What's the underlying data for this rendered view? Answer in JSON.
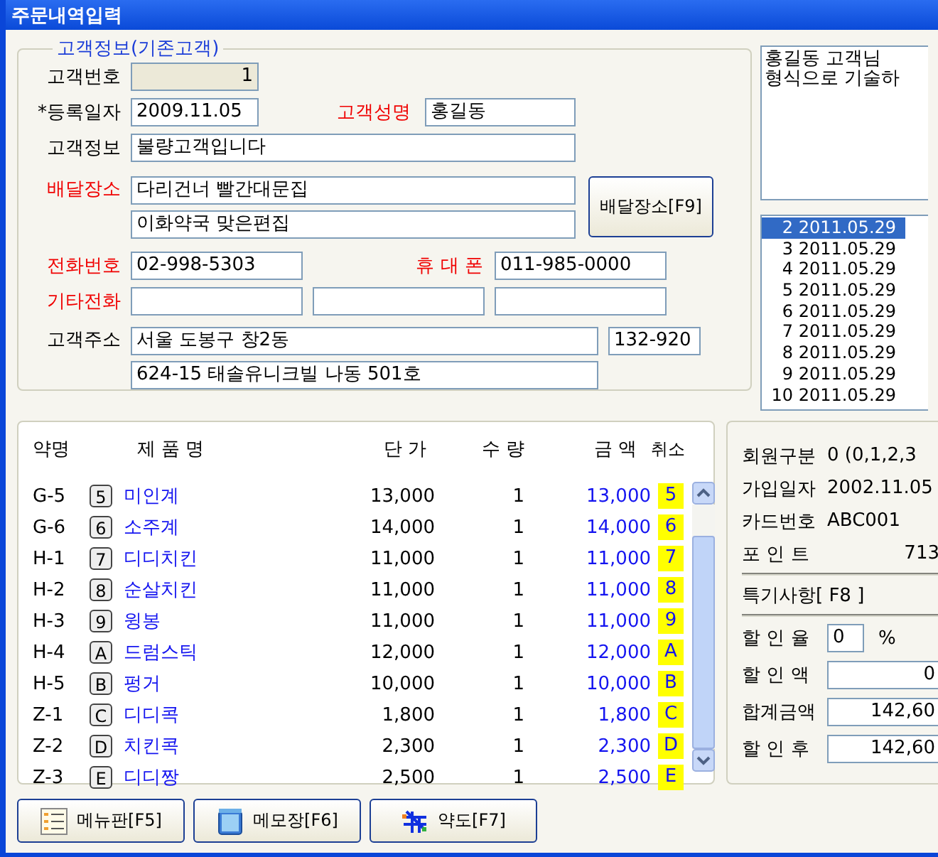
{
  "window": {
    "title": "주문내역입력"
  },
  "customer": {
    "legend": "고객정보(기존고객)",
    "number": {
      "label": "고객번호",
      "highlighted": false,
      "value": "1",
      "disabled": true
    },
    "reg_date": {
      "label": "*등록일자",
      "highlighted": false,
      "value": "2009.11.05"
    },
    "name": {
      "label": "고객성명",
      "highlighted": true,
      "value": "홍길동"
    },
    "info": {
      "label": "고객정보",
      "highlighted": false,
      "value": "불량고객입니다"
    },
    "delivery": {
      "label": "배달장소",
      "highlighted": true,
      "lines": [
        "다리건너 빨간대문집",
        "이화약국 맞은편집"
      ],
      "button": "배달장소[F9]"
    },
    "phone": {
      "label": "전화번호",
      "highlighted": true,
      "value": "02-998-5303"
    },
    "mobile": {
      "label": "휴 대 폰",
      "highlighted": true,
      "value": "011-985-0000"
    },
    "other_phone": {
      "label": "기타전화",
      "highlighted": true
    },
    "address": {
      "label": "고객주소",
      "highlighted": false,
      "lines": [
        "서울 도봉구 창2동",
        "624-15 태솔유니크빌 나동 501호"
      ],
      "zip": "132-920"
    }
  },
  "memo": {
    "lines": [
      "홍길동 고객님",
      "형식으로 기술하"
    ]
  },
  "history": [
    {
      "no": "2",
      "date": "2011.05.29",
      "selected": true
    },
    {
      "no": "3",
      "date": "2011.05.29",
      "selected": false
    },
    {
      "no": "4",
      "date": "2011.05.29",
      "selected": false
    },
    {
      "no": "5",
      "date": "2011.05.29",
      "selected": false
    },
    {
      "no": "6",
      "date": "2011.05.29",
      "selected": false
    },
    {
      "no": "7",
      "date": "2011.05.29",
      "selected": false
    },
    {
      "no": "8",
      "date": "2011.05.29",
      "selected": false
    },
    {
      "no": "9",
      "date": "2011.05.29",
      "selected": false
    },
    {
      "no": "10",
      "date": "2011.05.29",
      "selected": false
    }
  ],
  "products": {
    "columns": [
      "약명",
      "제 품 명",
      "단 가",
      "수 량",
      "금 액",
      "취소"
    ],
    "rows": [
      {
        "code": "G-5",
        "key": "5",
        "name": "미인계",
        "price": "13,000",
        "qty": "1",
        "amount": "13,000",
        "cancel": "5"
      },
      {
        "code": "G-6",
        "key": "6",
        "name": "소주계",
        "price": "14,000",
        "qty": "1",
        "amount": "14,000",
        "cancel": "6"
      },
      {
        "code": "H-1",
        "key": "7",
        "name": "디디치킨",
        "price": "11,000",
        "qty": "1",
        "amount": "11,000",
        "cancel": "7"
      },
      {
        "code": "H-2",
        "key": "8",
        "name": "순살치킨",
        "price": "11,000",
        "qty": "1",
        "amount": "11,000",
        "cancel": "8"
      },
      {
        "code": "H-3",
        "key": "9",
        "name": "윙봉",
        "price": "11,000",
        "qty": "1",
        "amount": "11,000",
        "cancel": "9"
      },
      {
        "code": "H-4",
        "key": "A",
        "name": "드럼스틱",
        "price": "12,000",
        "qty": "1",
        "amount": "12,000",
        "cancel": "A"
      },
      {
        "code": "H-5",
        "key": "B",
        "name": "펑거",
        "price": "10,000",
        "qty": "1",
        "amount": "10,000",
        "cancel": "B"
      },
      {
        "code": "Z-1",
        "key": "C",
        "name": "디디콕",
        "price": "1,800",
        "qty": "1",
        "amount": "1,800",
        "cancel": "C"
      },
      {
        "code": "Z-2",
        "key": "D",
        "name": "치킨콕",
        "price": "2,300",
        "qty": "1",
        "amount": "2,300",
        "cancel": "D"
      },
      {
        "code": "Z-3",
        "key": "E",
        "name": "디디짱",
        "price": "2,500",
        "qty": "1",
        "amount": "2,500",
        "cancel": "E"
      }
    ]
  },
  "summary": {
    "info": [
      {
        "label": "회원구분",
        "value": "0 (0,1,2,3"
      },
      {
        "label": "가입일자",
        "value": "2002.11.05"
      },
      {
        "label": "카드번호",
        "value": "ABC001"
      },
      {
        "label": "포 인 트",
        "value": "713"
      }
    ],
    "special": "특기사항[ F8 ]",
    "rate": {
      "label": "할 인 율",
      "value": "0",
      "unit": "%"
    },
    "amounts": [
      {
        "label": "할 인 액",
        "value": "0"
      },
      {
        "label": "합계금액",
        "value": "142,60"
      },
      {
        "label": "할 인 후",
        "value": "142,60"
      }
    ]
  },
  "buttons": [
    {
      "label": "메뉴판[F5]",
      "kind": "menu"
    },
    {
      "label": "메모장[F6]",
      "kind": "notepad"
    },
    {
      "label": "약도[F7]",
      "kind": "map"
    }
  ]
}
